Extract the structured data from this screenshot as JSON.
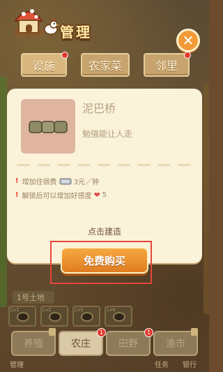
{
  "header": {
    "title": "管理"
  },
  "tabs": [
    {
      "label": "设施",
      "badge": true
    },
    {
      "label": "农家菜",
      "badge": false
    },
    {
      "label": "邻里",
      "badge": true
    }
  ],
  "item": {
    "name": "泥巴桥",
    "description": "勉强能让人走",
    "effect_1_prefix": "增加住宿费",
    "effect_1_value": "3元／钟",
    "effect_2_prefix": "解锁后可以增加好感度",
    "effect_2_value": "5"
  },
  "build": {
    "hint": "点击建造",
    "button_label": "免费购买"
  },
  "land": {
    "label": "1号土地",
    "slots": [
      "Lv1",
      "Lv2",
      "Lv3",
      "Lv4"
    ]
  },
  "bottom_tabs": [
    {
      "label": "养殖",
      "locked": true,
      "badge": ""
    },
    {
      "label": "农庄",
      "locked": false,
      "badge": "1"
    },
    {
      "label": "田野",
      "locked": false,
      "badge": "1"
    },
    {
      "label": "渔市",
      "locked": true,
      "badge": ""
    }
  ],
  "bottom_labels": [
    "管理",
    "任务",
    "银行"
  ],
  "colors": {
    "accent_orange": "#f29a38",
    "highlight_red": "#e5463b",
    "panel_bg": "#fbf2da"
  }
}
